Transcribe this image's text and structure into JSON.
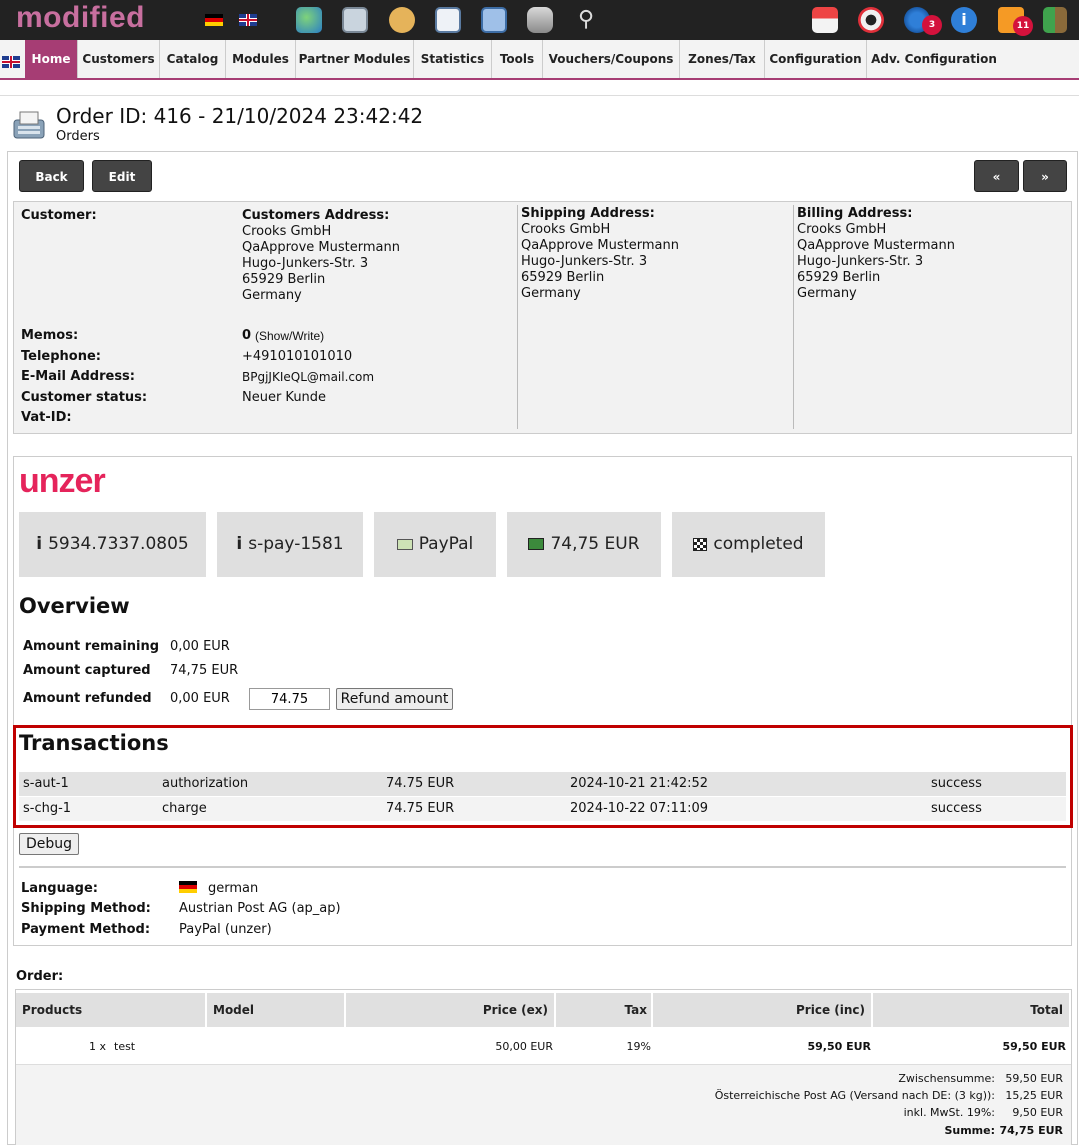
{
  "topbar": {
    "logo": "modified",
    "badges": {
      "sync": "3",
      "rss": "11"
    },
    "icons": [
      "de-flag-icon",
      "uk-flag-icon",
      "globe-icon",
      "orders-icon",
      "customers-icon",
      "forms-icon",
      "copy-icon",
      "database-icon",
      "search-icon",
      "shop-icon",
      "help-icon",
      "sync-icon",
      "info-icon",
      "rss-icon",
      "logout-icon"
    ]
  },
  "nav": {
    "items": [
      "Home",
      "Customers",
      "Catalog",
      "Modules",
      "Partner Modules",
      "Statistics",
      "Tools",
      "Vouchers/Coupons",
      "Zones/Tax",
      "Configuration",
      "Adv. Configuration"
    ]
  },
  "page": {
    "title": "Order ID: 416 - 21/10/2024 23:42:42",
    "subtitle": "Orders"
  },
  "buttons": {
    "back": "Back",
    "edit": "Edit",
    "prev": "«",
    "next": "»"
  },
  "customer": {
    "label_customer": "Customer:",
    "label_customers_address": "Customers Address:",
    "address": [
      "Crooks GmbH",
      "QaApprove Mustermann",
      "Hugo-Junkers-Str. 3",
      "65929 Berlin",
      "Germany"
    ],
    "label_memos": "Memos:",
    "memos_count": "0",
    "memos_link": "(Show/Write)",
    "label_telephone": "Telephone:",
    "telephone": "+491010101010",
    "label_email": "E-Mail Address:",
    "email": "BPgjJKIeQL@mail.com",
    "label_status": "Customer status:",
    "status": "Neuer Kunde",
    "label_vat": "Vat-ID:"
  },
  "shipping": {
    "label": "Shipping Address:",
    "address": [
      "Crooks GmbH",
      "QaApprove Mustermann",
      "Hugo-Junkers-Str. 3",
      "65929 Berlin",
      "Germany"
    ]
  },
  "billing": {
    "label": "Billing Address:",
    "address": [
      "Crooks GmbH",
      "QaApprove Mustermann",
      "Hugo-Junkers-Str. 3",
      "65929 Berlin",
      "Germany"
    ]
  },
  "unzer": {
    "logo": "unzer",
    "pills": [
      "5934.7337.0805",
      "s-pay-1581",
      "PayPal",
      "74,75 EUR",
      "completed"
    ],
    "overview_title": "Overview",
    "amount_remaining_label": "Amount remaining",
    "amount_remaining": "0,00 EUR",
    "amount_captured_label": "Amount captured",
    "amount_captured": "74,75 EUR",
    "amount_refunded_label": "Amount refunded",
    "amount_refunded": "0,00 EUR",
    "refund_input": "74.75",
    "refund_button": "Refund amount",
    "transactions_title": "Transactions",
    "transactions": [
      {
        "id": "s-aut-1",
        "type": "authorization",
        "amount": "74.75 EUR",
        "date": "2024-10-21 21:42:52",
        "status": "success"
      },
      {
        "id": "s-chg-1",
        "type": "charge",
        "amount": "74.75 EUR",
        "date": "2024-10-22 07:11:09",
        "status": "success"
      }
    ],
    "debug_button": "Debug"
  },
  "info": {
    "label_language": "Language:",
    "language": "german",
    "label_shipping": "Shipping Method:",
    "shipping": "Austrian Post AG (ap_ap)",
    "label_payment": "Payment Method:",
    "payment": "PayPal (unzer)"
  },
  "order": {
    "label": "Order:",
    "columns": [
      "Products",
      "Model",
      "Price (ex)",
      "Tax",
      "Price (inc)",
      "Total"
    ],
    "rows": [
      {
        "qty": "1 x",
        "product": "test",
        "model": "",
        "price_ex": "50,00 EUR",
        "tax": "19%",
        "price_inc": "59,50 EUR",
        "total": "59,50 EUR"
      }
    ],
    "totals": [
      {
        "label": "Zwischensumme:",
        "value": "59,50 EUR"
      },
      {
        "label": "Österreichische Post AG (Versand nach DE: (3 kg)):",
        "value": "15,25 EUR"
      },
      {
        "label": "inkl. MwSt. 19%:",
        "value": "9,50 EUR"
      },
      {
        "label": "Summe:",
        "value": "74,75 EUR"
      }
    ]
  },
  "colors": {
    "brand": "#a63d74",
    "topbar": "#222222",
    "unzer": "#e5245b",
    "highlight": "#c00000"
  }
}
